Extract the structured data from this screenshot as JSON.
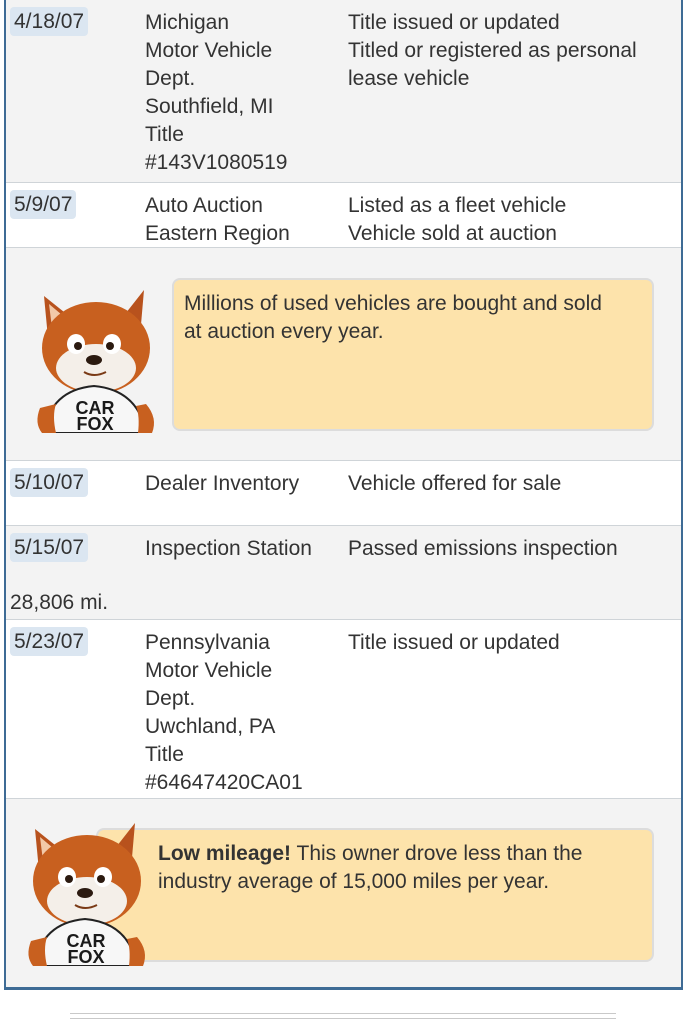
{
  "records": [
    {
      "date": "4/18/07",
      "source": [
        "Michigan",
        "Motor Vehicle",
        "Dept.",
        "Southfield, MI",
        "Title",
        "#143V1080519"
      ],
      "comments": [
        "Title issued or updated",
        "Titled or registered as personal",
        "lease vehicle"
      ]
    },
    {
      "date": "5/9/07",
      "source": [
        "Auto Auction",
        "Eastern Region"
      ],
      "comments": [
        "Listed as a fleet vehicle",
        "Vehicle sold at auction"
      ]
    },
    {
      "date": "5/10/07",
      "source": [
        "Dealer Inventory"
      ],
      "comments": [
        "Vehicle offered for sale"
      ]
    },
    {
      "date": "5/15/07",
      "odometer": "28,806 mi.",
      "source": [
        "Inspection Station"
      ],
      "comments": [
        "Passed emissions inspection"
      ]
    },
    {
      "date": "5/23/07",
      "source": [
        "Pennsylvania",
        "Motor Vehicle",
        "Dept.",
        "Uwchland, PA",
        "Title",
        "#64647420CA01"
      ],
      "comments": [
        "Title issued or updated"
      ]
    }
  ],
  "tips": {
    "auction": {
      "lines": [
        "Millions of used vehicles are bought and sold",
        "at auction every year."
      ]
    },
    "mileage": {
      "bold": "Low mileage!",
      "lines": [
        " This owner drove less than the",
        "industry average of 15,000 miles per year."
      ]
    }
  },
  "mascot": {
    "shirt_line1": "CAR",
    "shirt_line2": "FOX",
    "icon": "carfox-mascot"
  },
  "colors": {
    "tip_bg": "#fde3ab",
    "date_badge": "#dbe6f1",
    "frame": "#3e6b95"
  }
}
